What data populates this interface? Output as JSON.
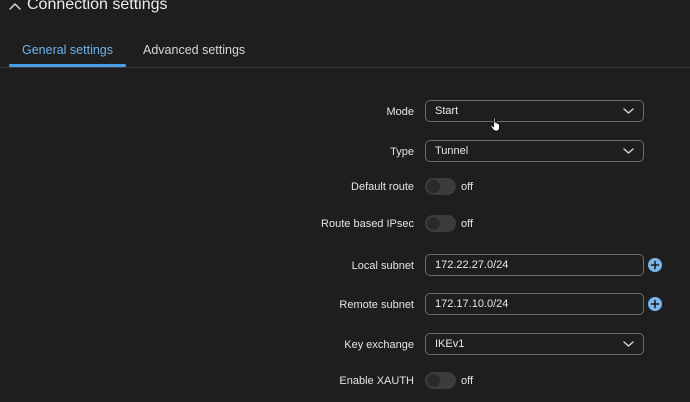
{
  "section": {
    "title": "Connection settings"
  },
  "tabs": [
    {
      "label": "General settings"
    },
    {
      "label": "Advanced settings"
    }
  ],
  "fields": {
    "mode": {
      "label": "Mode",
      "value": "Start"
    },
    "type": {
      "label": "Type",
      "value": "Tunnel"
    },
    "default_route": {
      "label": "Default route",
      "state": "off"
    },
    "route_based_ipsec": {
      "label": "Route based IPsec",
      "state": "off"
    },
    "local_subnet": {
      "label": "Local subnet",
      "value": "172.22.27.0/24"
    },
    "remote_subnet": {
      "label": "Remote subnet",
      "value": "172.17.10.0/24"
    },
    "key_exchange": {
      "label": "Key exchange",
      "value": "IKEv1"
    },
    "enable_xauth": {
      "label": "Enable XAUTH",
      "state": "off"
    }
  },
  "icons": {
    "section_toggle": "chevron-up-icon",
    "select_arrow": "chevron-down-icon",
    "add": "plus-circle-icon",
    "pointer": "hand-pointer-icon"
  },
  "colors": {
    "background": "#1e1e1e",
    "accent": "#4a9fe6",
    "active_tab_text": "#6fb3ef",
    "add_icon": "#79b6ea"
  }
}
